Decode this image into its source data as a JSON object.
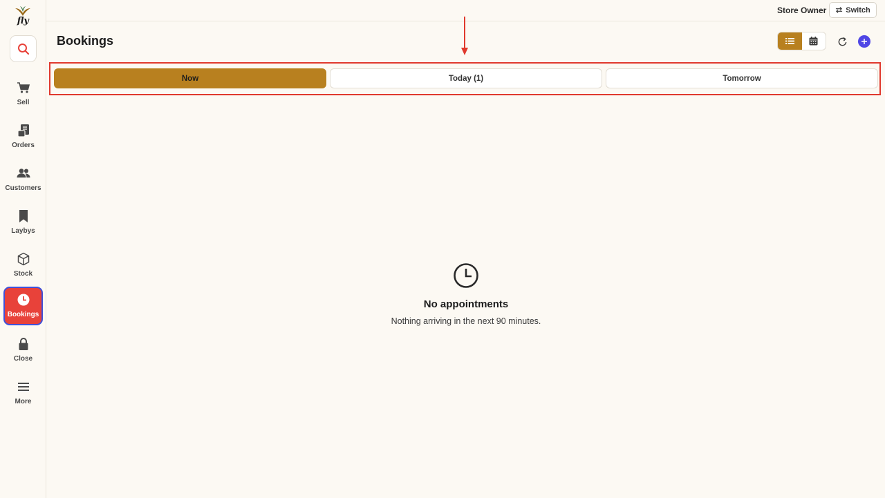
{
  "app": {
    "logo_text": "fly"
  },
  "sidebar": {
    "search_icon": "search-icon",
    "items": [
      {
        "label": "Sell",
        "icon": "cart-icon",
        "active": false
      },
      {
        "label": "Orders",
        "icon": "receipt-icon",
        "active": false
      },
      {
        "label": "Customers",
        "icon": "users-icon",
        "active": false
      },
      {
        "label": "Laybys",
        "icon": "bookmark-icon",
        "active": false
      },
      {
        "label": "Stock",
        "icon": "box-icon",
        "active": false
      },
      {
        "label": "Bookings",
        "icon": "clock-icon",
        "active": true
      },
      {
        "label": "Close",
        "icon": "lock-icon",
        "active": false
      },
      {
        "label": "More",
        "icon": "menu-icon",
        "active": false
      }
    ]
  },
  "topbar": {
    "user": "Store Owner",
    "switch_label": "Switch"
  },
  "header": {
    "title": "Bookings"
  },
  "tabs": [
    {
      "label": "Now",
      "active": true
    },
    {
      "label": "Today (1)",
      "active": false
    },
    {
      "label": "Tomorrow",
      "active": false
    }
  ],
  "empty_state": {
    "title": "No appointments",
    "subtitle": "Nothing arriving in the next 90 minutes."
  },
  "colors": {
    "accent": "#b8801f",
    "active_nav": "#e8423a",
    "annotation": "#e0392d",
    "primary": "#4f46e5"
  }
}
